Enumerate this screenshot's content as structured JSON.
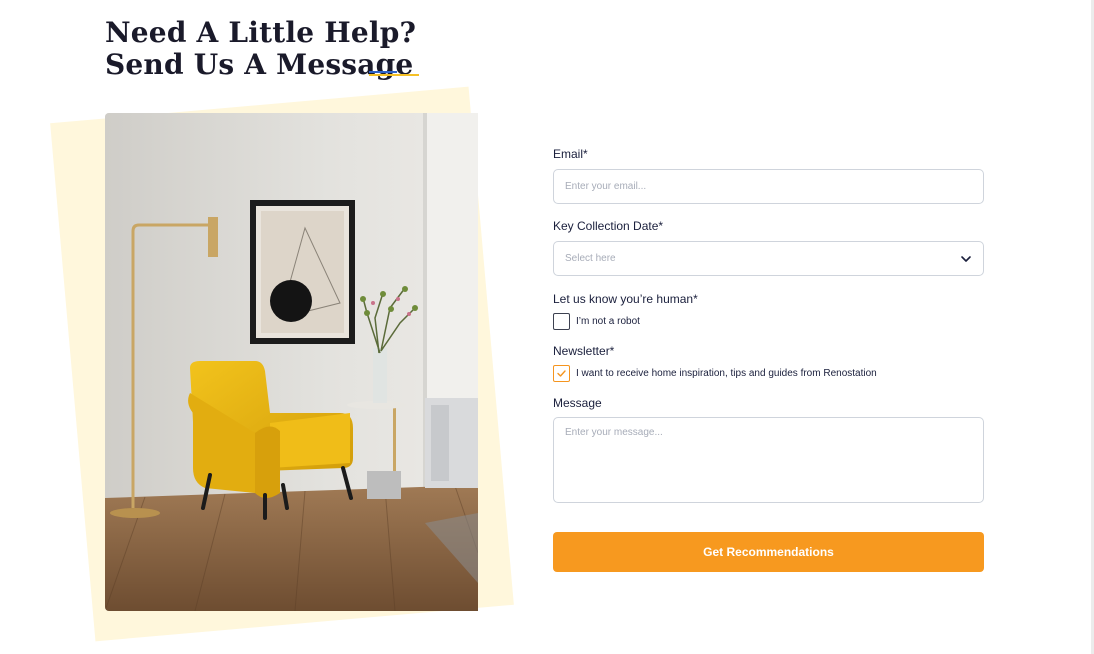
{
  "heading": {
    "line1": "Need A Little Help?",
    "line2": "Send Us A Message"
  },
  "accent_colors": {
    "deco_blue": "#2f63c9",
    "deco_yellow": "#f5c026",
    "button": "#f7991f",
    "backdrop": "#fff7dc"
  },
  "hero_image": {
    "alt": "Yellow armchair with floor lamp and framed artwork"
  },
  "form": {
    "email": {
      "label": "Email*",
      "placeholder": "Enter your email..."
    },
    "key_collection_date": {
      "label": "Key Collection Date*",
      "placeholder": "Select here",
      "icon": "chevron-down-icon"
    },
    "human_check": {
      "label": "Let us know you’re human*",
      "option": "I’m not a robot",
      "checked": false
    },
    "newsletter": {
      "label": "Newsletter*",
      "option": "I want to receive home inspiration, tips and guides from Renostation",
      "checked": true
    },
    "message": {
      "label": "Message",
      "placeholder": "Enter your message..."
    },
    "submit_label": "Get Recommendations"
  }
}
